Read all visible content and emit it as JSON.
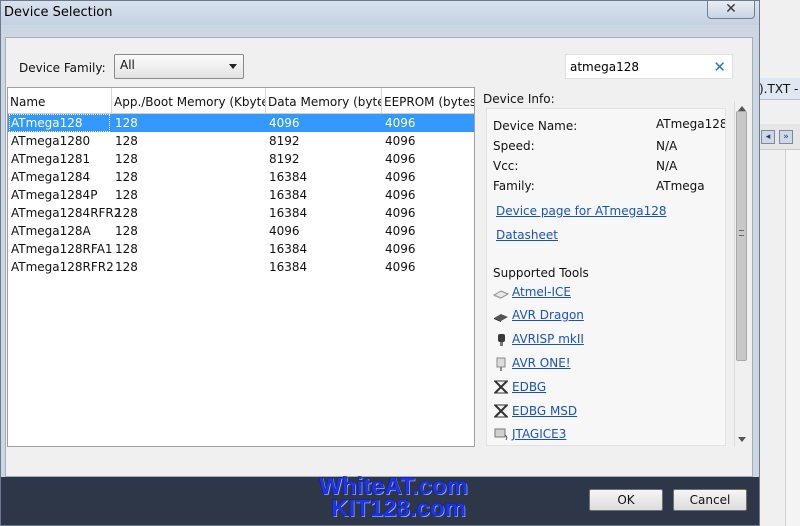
{
  "dialog": {
    "title": "Device Selection",
    "close_glyph": "✕"
  },
  "background": {
    "tab_label": ").TXT - "
  },
  "filter": {
    "family_label": "Device Family:",
    "family_value": "All",
    "search_value": "atmega128",
    "clear_glyph": "✕"
  },
  "grid": {
    "columns": [
      "Name",
      "App./Boot Memory (Kbytes)",
      "Data Memory (bytes)",
      "EEPROM (bytes)"
    ],
    "rows": [
      {
        "name": "ATmega128",
        "app": "128",
        "data": "4096",
        "eeprom": "4096"
      },
      {
        "name": "ATmega1280",
        "app": "128",
        "data": "8192",
        "eeprom": "4096"
      },
      {
        "name": "ATmega1281",
        "app": "128",
        "data": "8192",
        "eeprom": "4096"
      },
      {
        "name": "ATmega1284",
        "app": "128",
        "data": "16384",
        "eeprom": "4096"
      },
      {
        "name": "ATmega1284P",
        "app": "128",
        "data": "16384",
        "eeprom": "4096"
      },
      {
        "name": "ATmega1284RFR2",
        "app": "128",
        "data": "16384",
        "eeprom": "4096"
      },
      {
        "name": "ATmega128A",
        "app": "128",
        "data": "4096",
        "eeprom": "4096"
      },
      {
        "name": "ATmega128RFA1",
        "app": "128",
        "data": "16384",
        "eeprom": "4096"
      },
      {
        "name": "ATmega128RFR2",
        "app": "128",
        "data": "16384",
        "eeprom": "4096"
      }
    ],
    "selected_index": 0
  },
  "info": {
    "label": "Device Info:",
    "fields": [
      {
        "key": "Device Name:",
        "value": "ATmega128"
      },
      {
        "key": "Speed:",
        "value": "N/A"
      },
      {
        "key": "Vcc:",
        "value": "N/A"
      },
      {
        "key": "Family:",
        "value": "ATmega"
      }
    ],
    "device_page_link": "Device page for ATmega128",
    "datasheet_link": "Datasheet",
    "tools_title": "Supported Tools",
    "tools": [
      {
        "label": "Atmel-ICE",
        "icon": "atmel-ice-icon"
      },
      {
        "label": "AVR Dragon",
        "icon": "avr-dragon-icon"
      },
      {
        "label": "AVRISP mkII",
        "icon": "avrisp-icon"
      },
      {
        "label": "AVR ONE!",
        "icon": "avr-one-icon"
      },
      {
        "label": "EDBG",
        "icon": "edbg-icon"
      },
      {
        "label": "EDBG MSD",
        "icon": "edbg-msd-icon"
      },
      {
        "label": "JTAGICE3",
        "icon": "jtagice3-icon"
      }
    ]
  },
  "buttons": {
    "ok": "OK",
    "cancel": "Cancel"
  },
  "watermark": {
    "line1": "WhiteAT.com",
    "line2": "KIT128.com"
  },
  "colors": {
    "selection": "#3399ff",
    "link": "#1b54b5",
    "watermark": "#1c34f0",
    "bottom_bar": "#2d3747"
  }
}
